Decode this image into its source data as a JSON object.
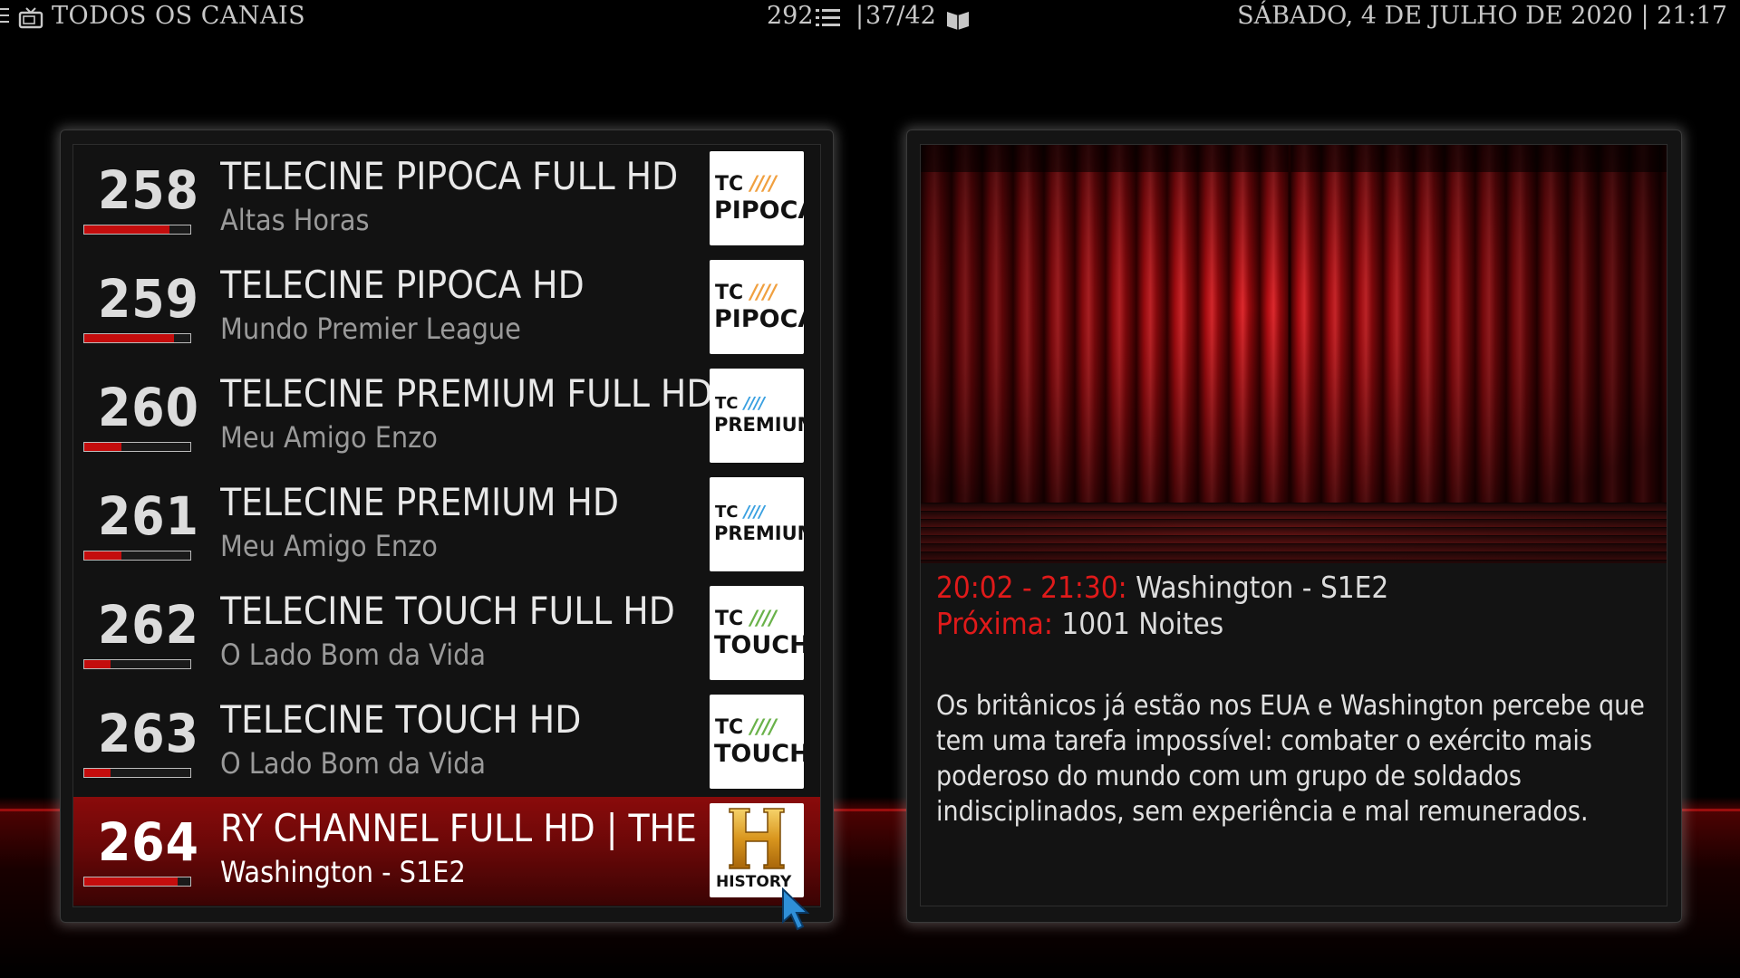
{
  "topbar": {
    "section_title": "TODOS OS CANAIS",
    "channel_count": "292",
    "separator": "|",
    "page": "37/42",
    "datetime": "SÁBADO, 4 DE JULHO DE 2020 | 21:17"
  },
  "channels": [
    {
      "number": "258",
      "name": "TELECINE PIPOCA FULL HD",
      "program": "Altas Horas",
      "progress": 0.8,
      "logo": {
        "tc": "TC",
        "slashes": "////",
        "brand": "PIPOCA"
      }
    },
    {
      "number": "259",
      "name": "TELECINE PIPOCA HD",
      "program": "Mundo Premier League",
      "progress": 0.85,
      "logo": {
        "tc": "TC",
        "slashes": "////",
        "brand": "PIPOCA"
      }
    },
    {
      "number": "260",
      "name": "TELECINE PREMIUM FULL HD",
      "program": "Meu Amigo Enzo",
      "progress": 0.35,
      "logo": {
        "tc": "TC",
        "slashes": "////",
        "brand": "PREMIUM"
      }
    },
    {
      "number": "261",
      "name": "TELECINE PREMIUM HD",
      "program": "Meu Amigo Enzo",
      "progress": 0.35,
      "logo": {
        "tc": "TC",
        "slashes": "////",
        "brand": "PREMIUM"
      }
    },
    {
      "number": "262",
      "name": "TELECINE TOUCH FULL HD",
      "program": "O Lado Bom da Vida",
      "progress": 0.25,
      "logo": {
        "tc": "TC",
        "slashes": "////",
        "brand": "TOUCH"
      }
    },
    {
      "number": "263",
      "name": "TELECINE TOUCH HD",
      "program": "O Lado Bom da Vida",
      "progress": 0.25,
      "logo": {
        "tc": "TC",
        "slashes": "////",
        "brand": "TOUCH"
      }
    },
    {
      "number": "264",
      "name": "RY CHANNEL FULL HD | THE HI",
      "program": "Washington - S1E2",
      "progress": 0.88,
      "logo": {
        "brand": "HISTORY"
      }
    }
  ],
  "details": {
    "now_time": "20:02 - 21:30:",
    "now_title": "Washington - S1E2",
    "next_label": "Próxima:",
    "next_title": "1001 Noites",
    "plot": "Os britânicos já estão nos EUA e Washington percebe que tem uma tarefa impossível: combater o exército mais poderoso do mundo com um grupo de soldados indisciplinados, sem experiência e mal remunerados."
  },
  "colors": {
    "accent_red": "#e01a1a",
    "selected_row": "#8a0b0b",
    "background": "#000000"
  }
}
